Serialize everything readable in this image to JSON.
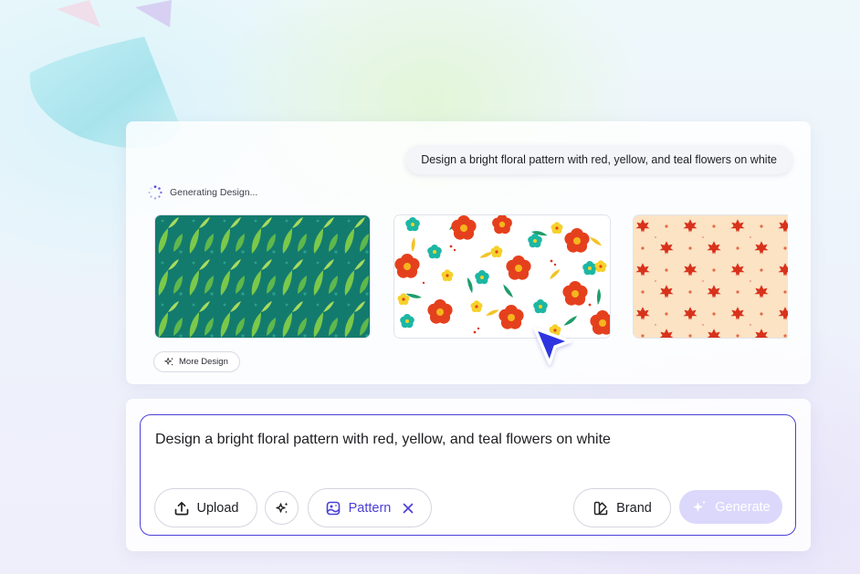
{
  "conversation": {
    "user_prompt": "Design a bright floral pattern with red, yellow, and teal flowers on white"
  },
  "status": {
    "text": "Generating Design...",
    "icon": "loading-spinner-icon"
  },
  "results": {
    "items": [
      {
        "name": "green-leaf-pattern",
        "background": "#137b6e"
      },
      {
        "name": "floral-pattern",
        "background": "#ffffff"
      },
      {
        "name": "maple-leaf-pattern",
        "background": "#fbe3c4"
      }
    ],
    "more_label": "More Design"
  },
  "composer": {
    "value": "Design a bright floral pattern with red, yellow, and teal flowers on white",
    "upload_label": "Upload",
    "pattern_label": "Pattern",
    "brand_label": "Brand",
    "generate_label": "Generate"
  },
  "colors": {
    "accent": "#4a3fd6",
    "generate_disabled": "#dcd8fb"
  }
}
